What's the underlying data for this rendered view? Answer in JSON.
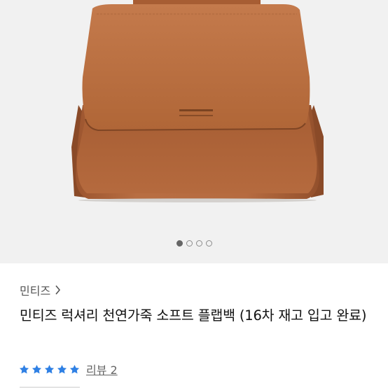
{
  "product": {
    "brand_label": "민티즈",
    "title": "민티즈 럭셔리 천연가죽 소프트 플랩백 (16차 재고 입고 완료)",
    "rating_stars": 5,
    "review_label": "리뷰 2"
  },
  "gallery": {
    "image_count": 4,
    "active_index": 0
  },
  "colors": {
    "bag_main": "#b46a3f",
    "bag_dark": "#8e4e2b",
    "star": "#2f80e4",
    "background": "#f1f1f1"
  },
  "icons": {
    "brand_chevron": "chevron-right-icon",
    "star": "star-icon"
  }
}
